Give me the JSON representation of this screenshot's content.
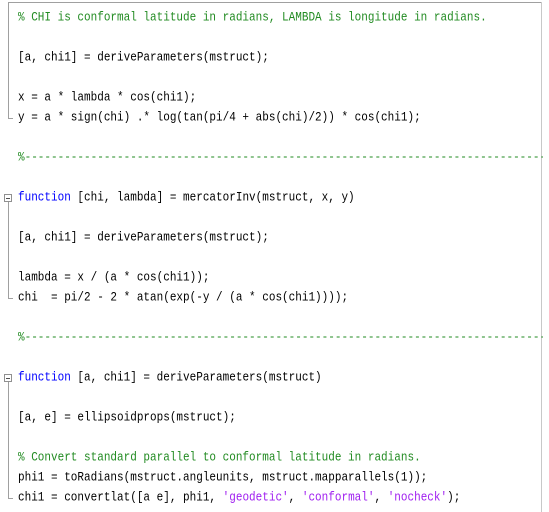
{
  "editor": {
    "lines": [
      {
        "tokens": [
          {
            "t": "% CHI is conformal latitude in radians, LAMBDA is longitude in radians.",
            "c": "cm"
          }
        ]
      },
      {
        "tokens": []
      },
      {
        "tokens": [
          {
            "t": "[a, chi1] = deriveParameters(mstruct);",
            "c": ""
          }
        ]
      },
      {
        "tokens": []
      },
      {
        "tokens": [
          {
            "t": "x = a * lambda * cos(chi1);",
            "c": ""
          }
        ]
      },
      {
        "tokens": [
          {
            "t": "y = a * sign(chi) .* log(tan(pi/4 + abs(chi)/2)) * cos(chi1);",
            "c": ""
          }
        ]
      },
      {
        "tokens": []
      },
      {
        "tokens": [
          {
            "t": "%-----------------------------------------------------------------------------------------",
            "c": "cm"
          }
        ]
      },
      {
        "tokens": []
      },
      {
        "tokens": [
          {
            "t": "function",
            "c": "kw"
          },
          {
            "t": " [chi, lambda] = mercatorInv(mstruct, x, y)",
            "c": ""
          }
        ]
      },
      {
        "tokens": []
      },
      {
        "tokens": [
          {
            "t": "[a, chi1] = deriveParameters(mstruct);",
            "c": ""
          }
        ]
      },
      {
        "tokens": []
      },
      {
        "tokens": [
          {
            "t": "lambda = x / (a * cos(chi1));",
            "c": ""
          }
        ]
      },
      {
        "tokens": [
          {
            "t": "chi  = pi/2 - 2 * atan(exp(-y / (a * cos(chi1))));",
            "c": ""
          }
        ]
      },
      {
        "tokens": []
      },
      {
        "tokens": [
          {
            "t": "%-----------------------------------------------------------------------------------------",
            "c": "cm"
          }
        ]
      },
      {
        "tokens": []
      },
      {
        "tokens": [
          {
            "t": "function",
            "c": "kw"
          },
          {
            "t": " [a, chi1] = deriveParameters(mstruct)",
            "c": ""
          }
        ]
      },
      {
        "tokens": []
      },
      {
        "tokens": [
          {
            "t": "[a, e] = ellipsoidprops(mstruct);",
            "c": ""
          }
        ]
      },
      {
        "tokens": []
      },
      {
        "tokens": [
          {
            "t": "% Convert standard parallel to conformal latitude in radians.",
            "c": "cm"
          }
        ]
      },
      {
        "tokens": [
          {
            "t": "phi1 = toRadians(mstruct.angleunits, mstruct.mapparallels(1));",
            "c": ""
          }
        ]
      },
      {
        "tokens": [
          {
            "t": "chi1 = convertlat([a e], phi1, ",
            "c": ""
          },
          {
            "t": "'geodetic'",
            "c": "st"
          },
          {
            "t": ", ",
            "c": ""
          },
          {
            "t": "'conformal'",
            "c": "st"
          },
          {
            "t": ", ",
            "c": ""
          },
          {
            "t": "'nocheck'",
            "c": "st"
          },
          {
            "t": ");",
            "c": ""
          }
        ]
      }
    ]
  },
  "colors": {
    "keyword": "#0000ff",
    "comment": "#228b22",
    "string": "#a020f0"
  }
}
